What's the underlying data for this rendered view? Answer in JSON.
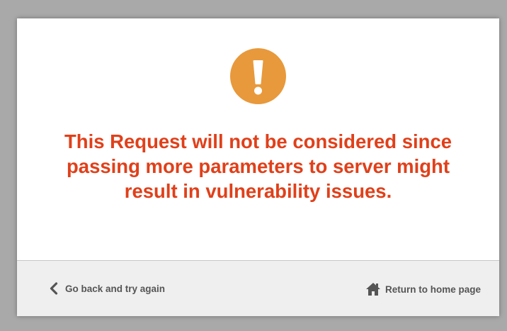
{
  "dialog": {
    "icon": "exclamation-warning-icon",
    "accent_color": "#e8993b",
    "message_color": "#e0401a",
    "message_lines": [
      "This Request will not be considered since",
      "passing more parameters to server might",
      "result in vulnerability issues."
    ]
  },
  "footer": {
    "back_link": {
      "label": "Go back and try again",
      "icon": "chevron-left-icon"
    },
    "home_link": {
      "label": "Return to home page",
      "icon": "home-icon"
    }
  }
}
